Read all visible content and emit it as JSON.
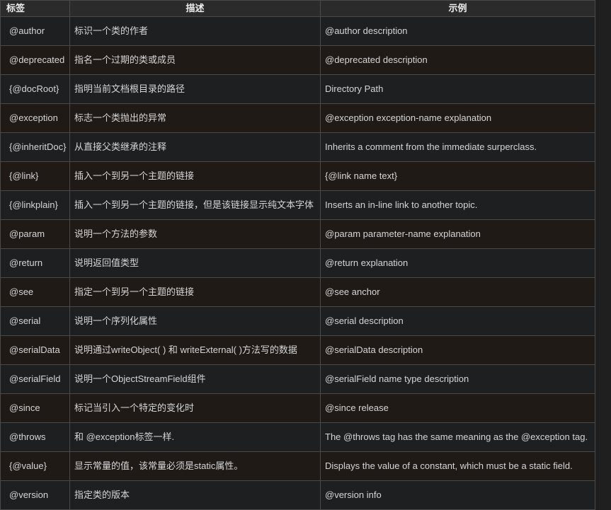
{
  "table": {
    "headers": {
      "tag": "标签",
      "description": "描述",
      "example": "示例"
    },
    "rows": [
      {
        "tag": "@author",
        "description": "标识一个类的作者",
        "example": "@author description"
      },
      {
        "tag": "@deprecated",
        "description": "指名一个过期的类或成员",
        "example": "@deprecated description"
      },
      {
        "tag": "{@docRoot}",
        "description": "指明当前文档根目录的路径",
        "example": "Directory Path"
      },
      {
        "tag": "@exception",
        "description": "标志一个类抛出的异常",
        "example": "@exception exception-name explanation"
      },
      {
        "tag": "{@inheritDoc}",
        "description": "从直接父类继承的注释",
        "example": "Inherits a comment from the immediate surperclass."
      },
      {
        "tag": "{@link}",
        "description": "插入一个到另一个主题的链接",
        "example": "{@link name text}"
      },
      {
        "tag": "{@linkplain}",
        "description": "插入一个到另一个主题的链接，但是该链接显示纯文本字体",
        "example": "Inserts an in-line link to another topic."
      },
      {
        "tag": "@param",
        "description": "说明一个方法的参数",
        "example": "@param parameter-name explanation"
      },
      {
        "tag": "@return",
        "description": "说明返回值类型",
        "example": "@return explanation"
      },
      {
        "tag": "@see",
        "description": "指定一个到另一个主题的链接",
        "example": "@see anchor"
      },
      {
        "tag": "@serial",
        "description": "说明一个序列化属性",
        "example": "@serial description"
      },
      {
        "tag": "@serialData",
        "description": "说明通过writeObject( ) 和 writeExternal( )方法写的数据",
        "example": "@serialData description"
      },
      {
        "tag": "@serialField",
        "description": "说明一个ObjectStreamField组件",
        "example": "@serialField name type description"
      },
      {
        "tag": "@since",
        "description": "标记当引入一个特定的变化时",
        "example": "@since release"
      },
      {
        "tag": "@throws",
        "description": "和 @exception标签一样.",
        "example": "The @throws tag has the same meaning as the @exception tag."
      },
      {
        "tag": "{@value}",
        "description": "显示常量的值，该常量必须是static属性。",
        "example": "Displays the value of a constant, which must be a static field."
      },
      {
        "tag": "@version",
        "description": "指定类的版本",
        "example": "@version info"
      }
    ]
  }
}
